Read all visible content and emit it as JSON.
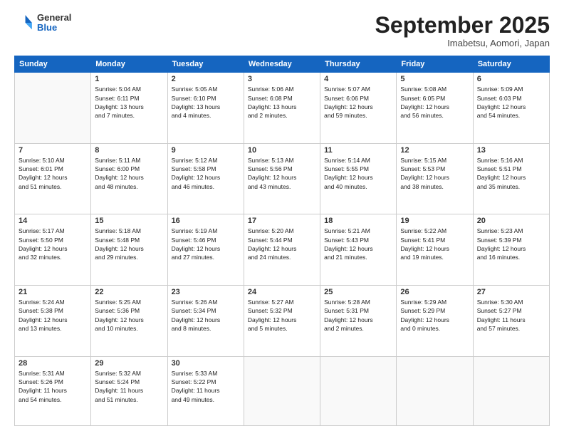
{
  "logo": {
    "general": "General",
    "blue": "Blue"
  },
  "header": {
    "month": "September 2025",
    "location": "Imabetsu, Aomori, Japan"
  },
  "weekdays": [
    "Sunday",
    "Monday",
    "Tuesday",
    "Wednesday",
    "Thursday",
    "Friday",
    "Saturday"
  ],
  "weeks": [
    [
      {
        "day": "",
        "info": ""
      },
      {
        "day": "1",
        "info": "Sunrise: 5:04 AM\nSunset: 6:11 PM\nDaylight: 13 hours\nand 7 minutes."
      },
      {
        "day": "2",
        "info": "Sunrise: 5:05 AM\nSunset: 6:10 PM\nDaylight: 13 hours\nand 4 minutes."
      },
      {
        "day": "3",
        "info": "Sunrise: 5:06 AM\nSunset: 6:08 PM\nDaylight: 13 hours\nand 2 minutes."
      },
      {
        "day": "4",
        "info": "Sunrise: 5:07 AM\nSunset: 6:06 PM\nDaylight: 12 hours\nand 59 minutes."
      },
      {
        "day": "5",
        "info": "Sunrise: 5:08 AM\nSunset: 6:05 PM\nDaylight: 12 hours\nand 56 minutes."
      },
      {
        "day": "6",
        "info": "Sunrise: 5:09 AM\nSunset: 6:03 PM\nDaylight: 12 hours\nand 54 minutes."
      }
    ],
    [
      {
        "day": "7",
        "info": "Sunrise: 5:10 AM\nSunset: 6:01 PM\nDaylight: 12 hours\nand 51 minutes."
      },
      {
        "day": "8",
        "info": "Sunrise: 5:11 AM\nSunset: 6:00 PM\nDaylight: 12 hours\nand 48 minutes."
      },
      {
        "day": "9",
        "info": "Sunrise: 5:12 AM\nSunset: 5:58 PM\nDaylight: 12 hours\nand 46 minutes."
      },
      {
        "day": "10",
        "info": "Sunrise: 5:13 AM\nSunset: 5:56 PM\nDaylight: 12 hours\nand 43 minutes."
      },
      {
        "day": "11",
        "info": "Sunrise: 5:14 AM\nSunset: 5:55 PM\nDaylight: 12 hours\nand 40 minutes."
      },
      {
        "day": "12",
        "info": "Sunrise: 5:15 AM\nSunset: 5:53 PM\nDaylight: 12 hours\nand 38 minutes."
      },
      {
        "day": "13",
        "info": "Sunrise: 5:16 AM\nSunset: 5:51 PM\nDaylight: 12 hours\nand 35 minutes."
      }
    ],
    [
      {
        "day": "14",
        "info": "Sunrise: 5:17 AM\nSunset: 5:50 PM\nDaylight: 12 hours\nand 32 minutes."
      },
      {
        "day": "15",
        "info": "Sunrise: 5:18 AM\nSunset: 5:48 PM\nDaylight: 12 hours\nand 29 minutes."
      },
      {
        "day": "16",
        "info": "Sunrise: 5:19 AM\nSunset: 5:46 PM\nDaylight: 12 hours\nand 27 minutes."
      },
      {
        "day": "17",
        "info": "Sunrise: 5:20 AM\nSunset: 5:44 PM\nDaylight: 12 hours\nand 24 minutes."
      },
      {
        "day": "18",
        "info": "Sunrise: 5:21 AM\nSunset: 5:43 PM\nDaylight: 12 hours\nand 21 minutes."
      },
      {
        "day": "19",
        "info": "Sunrise: 5:22 AM\nSunset: 5:41 PM\nDaylight: 12 hours\nand 19 minutes."
      },
      {
        "day": "20",
        "info": "Sunrise: 5:23 AM\nSunset: 5:39 PM\nDaylight: 12 hours\nand 16 minutes."
      }
    ],
    [
      {
        "day": "21",
        "info": "Sunrise: 5:24 AM\nSunset: 5:38 PM\nDaylight: 12 hours\nand 13 minutes."
      },
      {
        "day": "22",
        "info": "Sunrise: 5:25 AM\nSunset: 5:36 PM\nDaylight: 12 hours\nand 10 minutes."
      },
      {
        "day": "23",
        "info": "Sunrise: 5:26 AM\nSunset: 5:34 PM\nDaylight: 12 hours\nand 8 minutes."
      },
      {
        "day": "24",
        "info": "Sunrise: 5:27 AM\nSunset: 5:32 PM\nDaylight: 12 hours\nand 5 minutes."
      },
      {
        "day": "25",
        "info": "Sunrise: 5:28 AM\nSunset: 5:31 PM\nDaylight: 12 hours\nand 2 minutes."
      },
      {
        "day": "26",
        "info": "Sunrise: 5:29 AM\nSunset: 5:29 PM\nDaylight: 12 hours\nand 0 minutes."
      },
      {
        "day": "27",
        "info": "Sunrise: 5:30 AM\nSunset: 5:27 PM\nDaylight: 11 hours\nand 57 minutes."
      }
    ],
    [
      {
        "day": "28",
        "info": "Sunrise: 5:31 AM\nSunset: 5:26 PM\nDaylight: 11 hours\nand 54 minutes."
      },
      {
        "day": "29",
        "info": "Sunrise: 5:32 AM\nSunset: 5:24 PM\nDaylight: 11 hours\nand 51 minutes."
      },
      {
        "day": "30",
        "info": "Sunrise: 5:33 AM\nSunset: 5:22 PM\nDaylight: 11 hours\nand 49 minutes."
      },
      {
        "day": "",
        "info": ""
      },
      {
        "day": "",
        "info": ""
      },
      {
        "day": "",
        "info": ""
      },
      {
        "day": "",
        "info": ""
      }
    ]
  ]
}
